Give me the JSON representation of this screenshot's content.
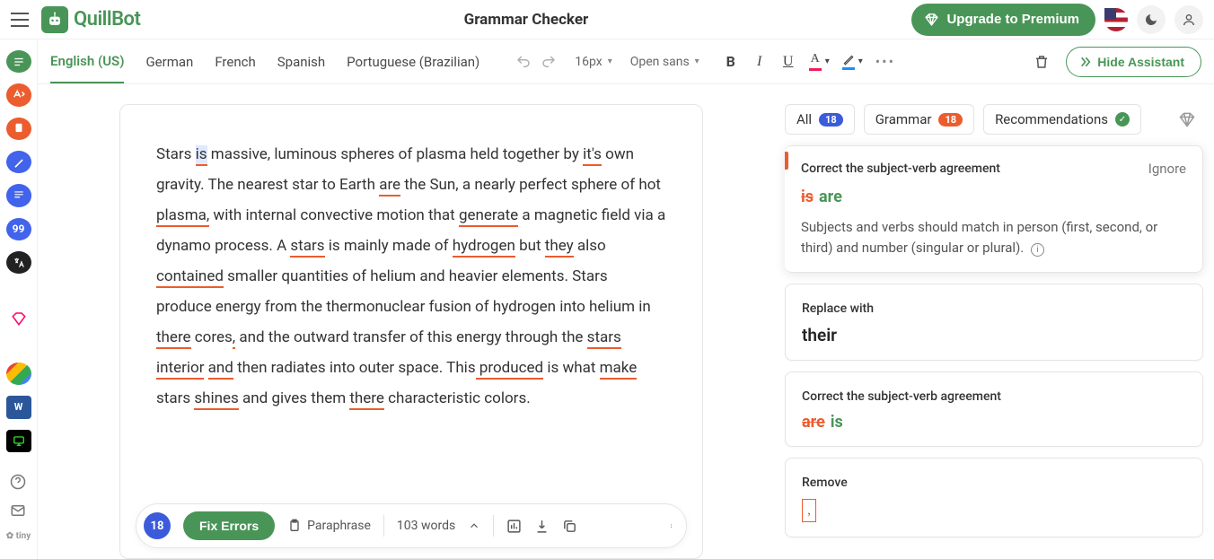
{
  "header": {
    "brand": "QuillBot",
    "title": "Grammar Checker",
    "upgrade": "Upgrade to Premium"
  },
  "languages": {
    "active": "English (US)",
    "tabs": [
      "English (US)",
      "German",
      "French",
      "Spanish",
      "Portuguese (Brazilian)"
    ]
  },
  "toolbar": {
    "font_size": "16px",
    "font_family": "Open sans",
    "hide_assistant": "Hide Assistant"
  },
  "rail": {
    "tiny": "✿ tiny"
  },
  "editor": {
    "text_segments": [
      {
        "t": "Stars "
      },
      {
        "t": "is",
        "err": true,
        "hl": true
      },
      {
        "t": " massive, luminous spheres of plasma held together by "
      },
      {
        "t": "it's",
        "err": true
      },
      {
        "t": " own gravity. The nearest star to Earth "
      },
      {
        "t": "are",
        "err": true
      },
      {
        "t": " the Sun, a nearly perfect sphere of hot "
      },
      {
        "t": "plasma,",
        "err": true
      },
      {
        "t": " with internal convective motion that "
      },
      {
        "t": "generate",
        "err": true
      },
      {
        "t": " a magnetic field via a dynamo process. A "
      },
      {
        "t": "stars",
        "err": true
      },
      {
        "t": " is mainly made of "
      },
      {
        "t": "hydrogen",
        "err": true
      },
      {
        "t": " but "
      },
      {
        "t": "they",
        "err": true
      },
      {
        "t": " also "
      },
      {
        "t": "contained",
        "err": true
      },
      {
        "t": " smaller quantities of helium and heavier elements. Stars produce energy from the thermonuclear fusion of hydrogen into helium in "
      },
      {
        "t": "there",
        "err": true
      },
      {
        "t": " cores"
      },
      {
        "t": ",",
        "err": true
      },
      {
        "t": " and the outward transfer of this energy through the "
      },
      {
        "t": "stars",
        "err": true
      },
      {
        "t": " "
      },
      {
        "t": "interior",
        "err": true
      },
      {
        "t": " "
      },
      {
        "t": "and",
        "err": true
      },
      {
        "t": " then radiates into outer space. This"
      },
      {
        "t": " produced",
        "err": true
      },
      {
        "t": " is what "
      },
      {
        "t": "make",
        "err": true
      },
      {
        "t": " stars "
      },
      {
        "t": "shines",
        "err": true
      },
      {
        "t": " and gives them "
      },
      {
        "t": "there",
        "err": true
      },
      {
        "t": " characteristic colors."
      }
    ]
  },
  "footer": {
    "error_count": "18",
    "fix_label": "Fix Errors",
    "paraphrase": "Paraphrase",
    "word_count": "103 words"
  },
  "assistant": {
    "tabs": {
      "all": "All",
      "all_count": "18",
      "grammar": "Grammar",
      "grammar_count": "18",
      "recommendations": "Recommendations"
    },
    "cards": [
      {
        "title": "Correct the subject-verb agreement",
        "ignore": "Ignore",
        "strike": "is",
        "add": "are",
        "desc": "Subjects and verbs should match in person (first, second, or third) and number (singular or plural).",
        "active": true
      },
      {
        "title": "Replace with",
        "value": "their"
      },
      {
        "title": "Correct the subject-verb agreement",
        "strike": "are",
        "add": "is"
      },
      {
        "title": "Remove",
        "remove": ","
      }
    ]
  }
}
